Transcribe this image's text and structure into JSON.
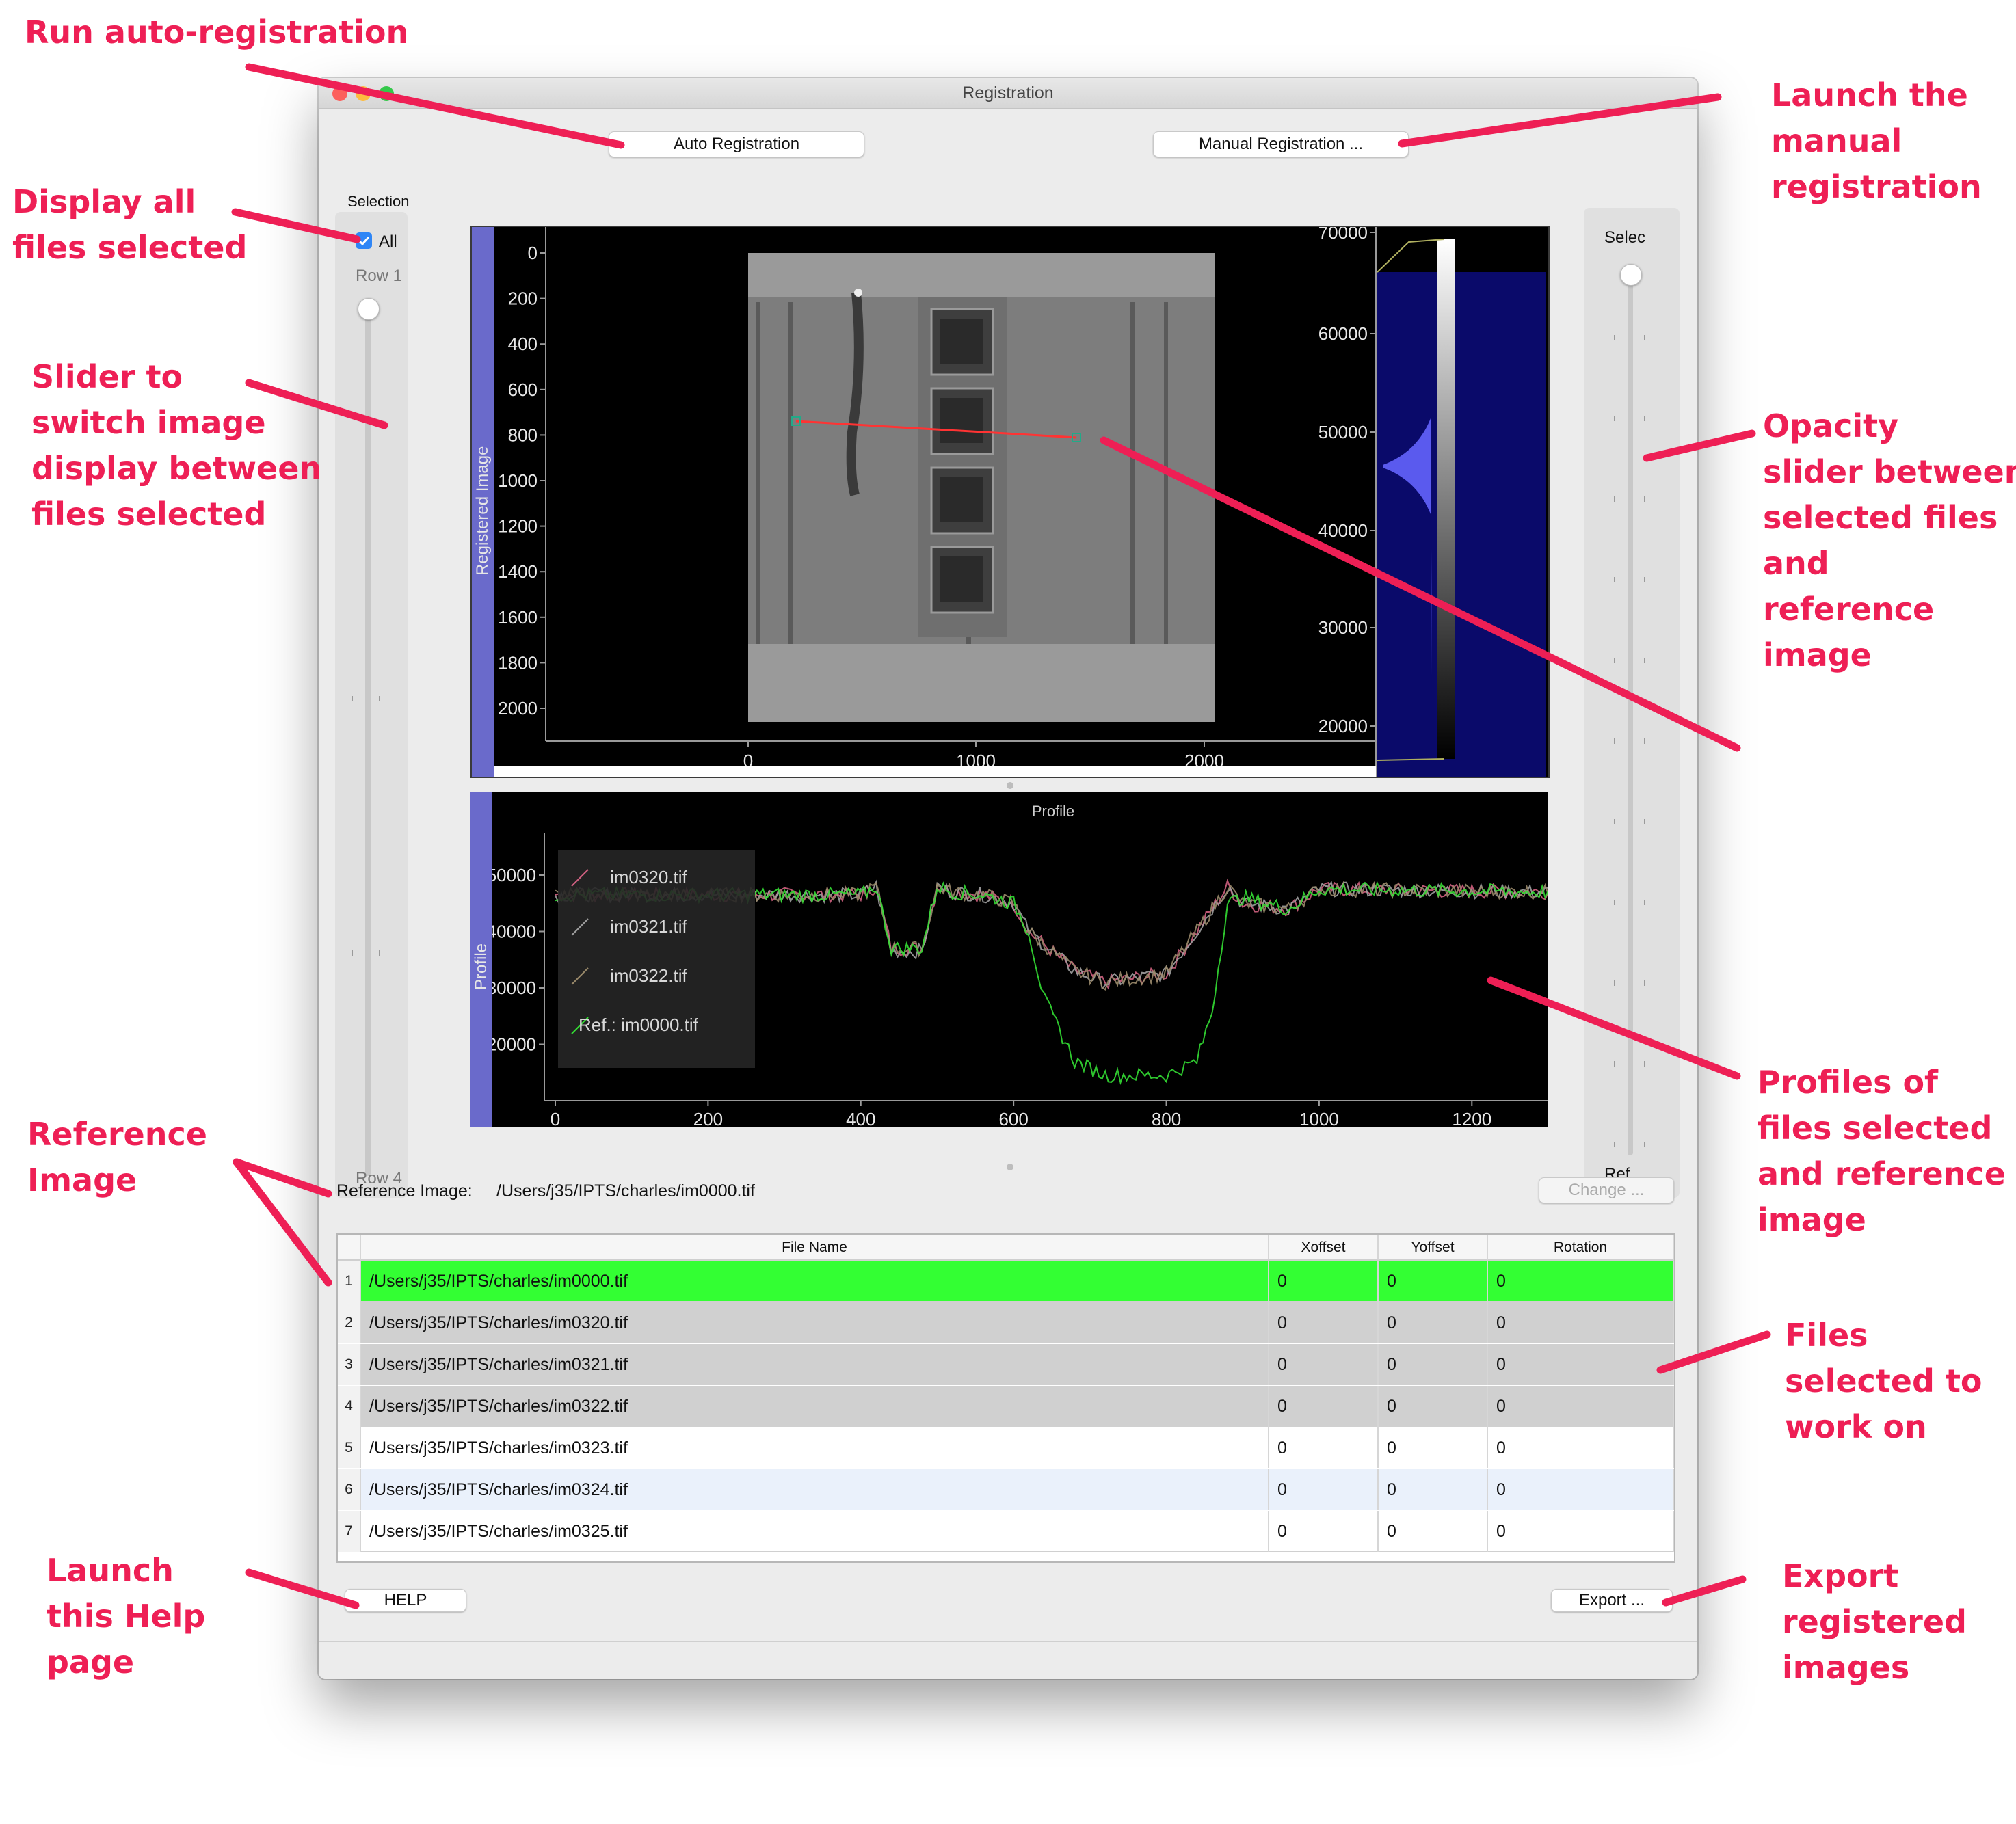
{
  "window": {
    "title": "Registration"
  },
  "toolbar": {
    "auto_label": "Auto Registration",
    "manual_label": "Manual Registration ..."
  },
  "left_slider": {
    "group_label": "Selection",
    "checkbox_label": "All",
    "checked": true,
    "top_label": "Row 1",
    "bottom_label": "Row 4",
    "value": 0
  },
  "right_slider": {
    "top_label": "Selec",
    "bottom_label": "Ref.",
    "value": 1.0
  },
  "image_view": {
    "side_label": "Registered Image",
    "y_ticks": [
      "0",
      "200",
      "400",
      "600",
      "800",
      "1000",
      "1200",
      "1400",
      "1600",
      "1800",
      "2000"
    ],
    "x_ticks": [
      "0",
      "1000",
      "2000"
    ],
    "hist_ticks": [
      "70000",
      "60000",
      "50000",
      "40000",
      "30000",
      "20000"
    ]
  },
  "profile_view": {
    "title": "Profile",
    "side_label": "Profile",
    "y_ticks": [
      "50000",
      "40000",
      "30000",
      "20000"
    ],
    "x_ticks": [
      "0",
      "200",
      "400",
      "600",
      "800",
      "1000",
      "1200"
    ],
    "legend": [
      "im0320.tif",
      "im0321.tif",
      "im0322.tif",
      "Ref.: im0000.tif"
    ]
  },
  "chart_data": {
    "type": "line",
    "title": "Profile",
    "xlim": [
      0,
      1300
    ],
    "ylim": [
      10000,
      55000
    ],
    "series": [
      {
        "name": "im0320.tif",
        "color": "#d06080",
        "x": [
          0,
          400,
          420,
          440,
          480,
          500,
          520,
          560,
          600,
          620,
          680,
          720,
          800,
          850,
          880,
          900,
          960,
          1000,
          1300
        ],
        "y": [
          46500,
          46500,
          48000,
          37000,
          37000,
          48000,
          47000,
          46500,
          45000,
          40000,
          33000,
          31000,
          32500,
          42000,
          48000,
          45000,
          44000,
          47500,
          47000
        ]
      },
      {
        "name": "im0321.tif",
        "color": "#a0a0a0",
        "x": [
          0,
          400,
          420,
          440,
          480,
          500,
          520,
          560,
          600,
          620,
          680,
          720,
          800,
          850,
          880,
          900,
          960,
          1000,
          1300
        ],
        "y": [
          46500,
          46500,
          48000,
          36500,
          36500,
          48000,
          47000,
          46500,
          45000,
          40000,
          33000,
          31000,
          32500,
          42000,
          48000,
          45000,
          44000,
          47500,
          47000
        ]
      },
      {
        "name": "im0322.tif",
        "color": "#9a8a6a",
        "x": [
          0,
          400,
          420,
          440,
          480,
          500,
          520,
          560,
          600,
          620,
          680,
          720,
          800,
          850,
          880,
          900,
          960,
          1000,
          1300
        ],
        "y": [
          46500,
          46500,
          48000,
          37000,
          37000,
          48000,
          47000,
          46500,
          45000,
          40000,
          33000,
          31000,
          32500,
          42000,
          48000,
          45000,
          44000,
          47500,
          47000
        ]
      },
      {
        "name": "Ref.: im0000.tif",
        "color": "#33dd33",
        "x": [
          0,
          400,
          420,
          440,
          480,
          500,
          520,
          560,
          600,
          620,
          640,
          680,
          720,
          800,
          840,
          860,
          880,
          900,
          960,
          1000,
          1300
        ],
        "y": [
          46500,
          46500,
          48000,
          37000,
          37000,
          48000,
          47000,
          46500,
          45000,
          40000,
          28000,
          17000,
          14500,
          14500,
          17000,
          26000,
          45000,
          46000,
          44000,
          47500,
          47000
        ]
      }
    ]
  },
  "reference": {
    "label": "Reference Image:",
    "path": "/Users/j35/IPTS/charles/im0000.tif",
    "change_label": "Change ..."
  },
  "table": {
    "headers": [
      "File Name",
      "Xoffset",
      "Yoffset",
      "Rotation"
    ],
    "rows": [
      {
        "n": "1",
        "file": "/Users/j35/IPTS/charles/im0000.tif",
        "x": "0",
        "y": "0",
        "r": "0"
      },
      {
        "n": "2",
        "file": "/Users/j35/IPTS/charles/im0320.tif",
        "x": "0",
        "y": "0",
        "r": "0"
      },
      {
        "n": "3",
        "file": "/Users/j35/IPTS/charles/im0321.tif",
        "x": "0",
        "y": "0",
        "r": "0"
      },
      {
        "n": "4",
        "file": "/Users/j35/IPTS/charles/im0322.tif",
        "x": "0",
        "y": "0",
        "r": "0"
      },
      {
        "n": "5",
        "file": "/Users/j35/IPTS/charles/im0323.tif",
        "x": "0",
        "y": "0",
        "r": "0"
      },
      {
        "n": "6",
        "file": "/Users/j35/IPTS/charles/im0324.tif",
        "x": "0",
        "y": "0",
        "r": "0"
      },
      {
        "n": "7",
        "file": "/Users/j35/IPTS/charles/im0325.tif",
        "x": "0",
        "y": "0",
        "r": "0"
      }
    ],
    "colors": {
      "reference": "#33ff33",
      "selected": "#d0d0d0",
      "alt": "#eaf1fb",
      "plain": "#ffffff"
    }
  },
  "footer": {
    "help_label": "HELP",
    "export_label": "Export ..."
  },
  "annotations": {
    "run_auto": "Run auto-registration",
    "display_all": [
      "Display all",
      "files selected"
    ],
    "slider_switch": [
      "Slider to",
      "switch image",
      "display between",
      "files selected"
    ],
    "reference_image": [
      "Reference",
      "Image"
    ],
    "launch_help": [
      "Launch",
      "this Help",
      "page"
    ],
    "launch_manual": [
      "Launch the",
      "manual",
      "registration"
    ],
    "opacity": [
      "Opacity",
      "slider between",
      "selected files",
      "and",
      "reference",
      "image"
    ],
    "profiles": [
      "Profiles of",
      "files selected",
      "and reference",
      "image"
    ],
    "files_selected": [
      "Files",
      "selected to",
      "work on"
    ],
    "export": [
      "Export",
      "registered",
      "images"
    ],
    "color": "#ee1f55"
  }
}
